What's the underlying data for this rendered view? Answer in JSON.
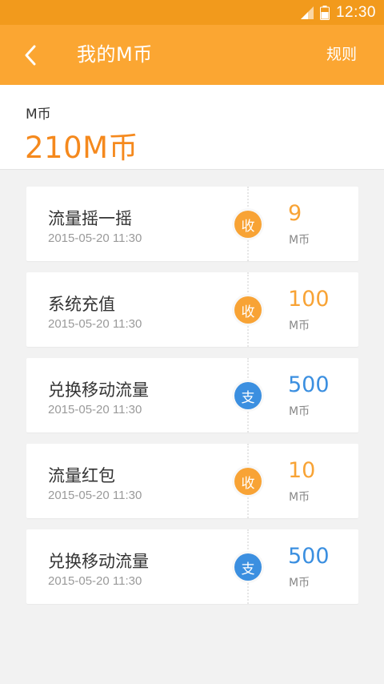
{
  "status_bar": {
    "time": "12:30"
  },
  "app_bar": {
    "title": "我的M币",
    "rules_label": "规则"
  },
  "balance": {
    "label": "M币",
    "value": "210M币"
  },
  "colors": {
    "income": "#f8a335",
    "expense": "#3b8fe0"
  },
  "transactions": [
    {
      "title": "流量摇一摇",
      "time": "2015-05-20 11:30",
      "badge": "收",
      "amount": "9",
      "unit": "M币",
      "type": "income"
    },
    {
      "title": "系统充值",
      "time": "2015-05-20 11:30",
      "badge": "收",
      "amount": "100",
      "unit": "M币",
      "type": "income"
    },
    {
      "title": "兑换移动流量",
      "time": "2015-05-20 11:30",
      "badge": "支",
      "amount": "500",
      "unit": "M币",
      "type": "expense"
    },
    {
      "title": "流量红包",
      "time": "2015-05-20 11:30",
      "badge": "收",
      "amount": "10",
      "unit": "M币",
      "type": "income"
    },
    {
      "title": "兑换移动流量",
      "time": "2015-05-20 11:30",
      "badge": "支",
      "amount": "500",
      "unit": "M币",
      "type": "expense"
    }
  ]
}
